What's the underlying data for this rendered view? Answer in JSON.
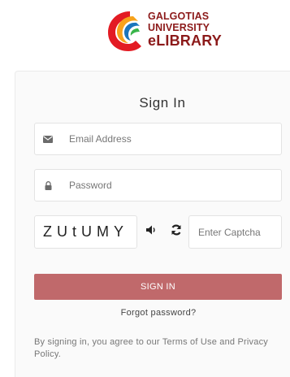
{
  "logo": {
    "line1": "GALGOTIAS",
    "line2": "UNIVERSITY",
    "line3": "eLIBRARY"
  },
  "form": {
    "title": "Sign In",
    "email_placeholder": "Email Address",
    "password_placeholder": "Password",
    "captcha_text": "ZUtUMY",
    "captcha_placeholder": "Enter Captcha",
    "submit_label": "SIGN IN",
    "forgot_label": "Forgot password?",
    "terms_text": "By signing in, you agree to our Terms of Use and Privacy Policy."
  },
  "icons": {
    "email": "envelope-icon",
    "password": "lock-icon",
    "audio": "speaker-icon",
    "refresh": "refresh-icon"
  },
  "colors": {
    "brand": "#8c1a1a",
    "button": "#c0696b"
  }
}
